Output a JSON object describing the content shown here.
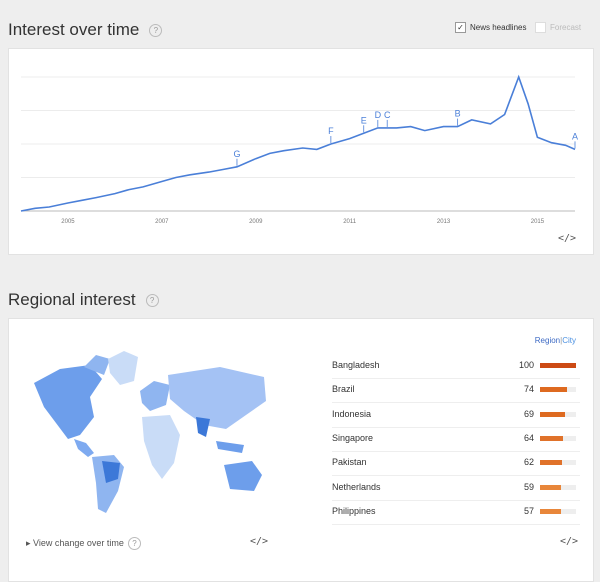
{
  "interest": {
    "title": "Interest over time",
    "options": {
      "news_label": "News headlines",
      "forecast_label": "Forecast"
    },
    "embed_glyph": "</>"
  },
  "chart_data": {
    "type": "line",
    "x_ticks": [
      "2005",
      "2007",
      "2009",
      "2011",
      "2013",
      "2015"
    ],
    "x": [
      2004.0,
      2004.3,
      2004.6,
      2005.0,
      2005.3,
      2005.6,
      2006.0,
      2006.3,
      2006.6,
      2007.0,
      2007.3,
      2007.6,
      2008.0,
      2008.3,
      2008.6,
      2009.0,
      2009.3,
      2009.6,
      2010.0,
      2010.3,
      2010.6,
      2011.0,
      2011.3,
      2011.6,
      2012.0,
      2012.3,
      2012.6,
      2013.0,
      2013.3,
      2013.6,
      2014.0,
      2014.3,
      2014.6,
      2014.8,
      2015.0,
      2015.3,
      2015.6,
      2015.8
    ],
    "values": [
      0,
      2,
      3,
      6,
      8,
      10,
      13,
      16,
      18,
      22,
      25,
      27,
      29,
      31,
      33,
      39,
      43,
      45,
      47,
      46,
      50,
      54,
      58,
      62,
      62,
      63,
      60,
      63,
      63,
      68,
      65,
      72,
      100,
      80,
      55,
      51,
      49,
      46
    ],
    "ylim": [
      0,
      100
    ],
    "annotations": [
      {
        "label": "G",
        "x": 2008.6,
        "y": 33
      },
      {
        "label": "F",
        "x": 2010.6,
        "y": 50
      },
      {
        "label": "E",
        "x": 2011.3,
        "y": 58
      },
      {
        "label": "D",
        "x": 2011.6,
        "y": 62
      },
      {
        "label": "C",
        "x": 2011.8,
        "y": 62
      },
      {
        "label": "B",
        "x": 2013.3,
        "y": 63
      },
      {
        "label": "A",
        "x": 2015.8,
        "y": 46
      }
    ]
  },
  "regional": {
    "title": "Regional interest",
    "toggle": {
      "region": "Region",
      "sep": "|",
      "city": "City"
    },
    "rows": [
      {
        "name": "Bangladesh",
        "value": "100",
        "pct": 100,
        "color": "#cc4a14"
      },
      {
        "name": "Brazil",
        "value": "74",
        "pct": 74,
        "color": "#de6a20"
      },
      {
        "name": "Indonesia",
        "value": "69",
        "pct": 69,
        "color": "#de6a20"
      },
      {
        "name": "Singapore",
        "value": "64",
        "pct": 64,
        "color": "#e0722a"
      },
      {
        "name": "Pakistan",
        "value": "62",
        "pct": 62,
        "color": "#e0722a"
      },
      {
        "name": "Netherlands",
        "value": "59",
        "pct": 59,
        "color": "#e8863a"
      },
      {
        "name": "Philippines",
        "value": "57",
        "pct": 57,
        "color": "#e8863a"
      }
    ],
    "view_change": "View change over time",
    "embed_glyph": "</>"
  }
}
